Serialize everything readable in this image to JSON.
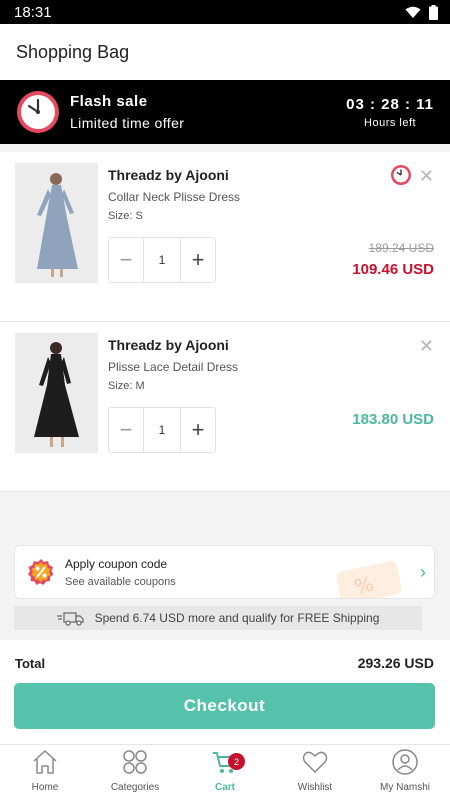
{
  "status": {
    "time": "18:31"
  },
  "header": {
    "title": "Shopping Bag"
  },
  "flash_sale": {
    "title": "Flash sale",
    "subtitle": "Limited time offer",
    "timer": "03 : 28 : 11",
    "timer_label": "Hours left"
  },
  "items": [
    {
      "brand": "Threadz by Ajooni",
      "name": "Collar Neck Plisse Dress",
      "size": "Size: S",
      "qty": "1",
      "old_price": "189.24 USD",
      "price": "109.46 USD"
    },
    {
      "brand": "Threadz by Ajooni",
      "name": "Plisse Lace Detail Dress",
      "size": "Size: M",
      "qty": "1",
      "price": "183.80 USD"
    }
  ],
  "coupon": {
    "title": "Apply coupon code",
    "subtitle": "See available coupons"
  },
  "shipping": {
    "text": "Spend 6.74 USD more and qualify for FREE Shipping"
  },
  "total": {
    "label": "Total",
    "value": "293.26 USD"
  },
  "checkout": {
    "label": "Checkout"
  },
  "tabs": [
    {
      "label": "Home",
      "icon": "home-icon"
    },
    {
      "label": "Categories",
      "icon": "categories-icon"
    },
    {
      "label": "Cart",
      "icon": "cart-icon",
      "badge": "2"
    },
    {
      "label": "Wishlist",
      "icon": "heart-icon"
    },
    {
      "label": "My Namshi",
      "icon": "user-icon"
    }
  ],
  "colors": {
    "accent": "#56c2ac",
    "sale": "#c8102e",
    "flash_bg": "#000000"
  }
}
